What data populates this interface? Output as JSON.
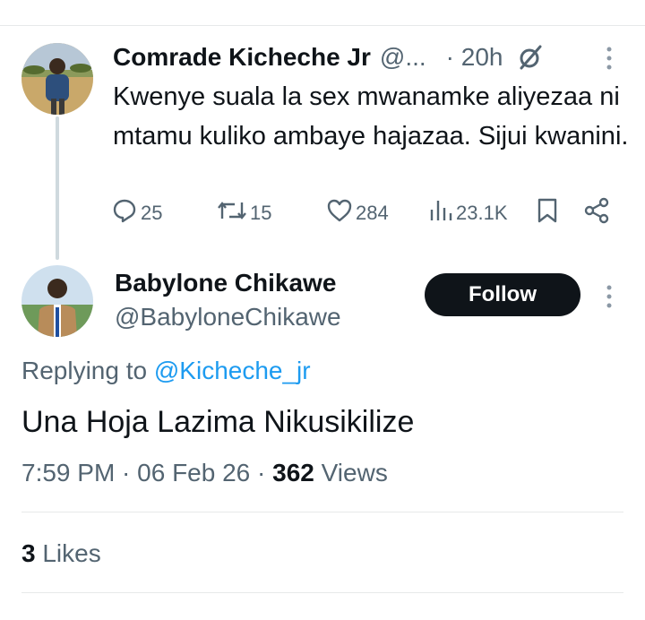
{
  "tweet1": {
    "author_name": "Comrade Kicheche Jr",
    "handle": "@...",
    "time": "· 20h",
    "text": "Kwenye suala la sex mwanamke aliyezaa ni mtamu kuliko ambaye hajazaa. Sijui kwanini.",
    "replies": "25",
    "retweets": "15",
    "likes": "284",
    "views": "23.1K",
    "icons": [
      "grok-icon",
      "more-icon",
      "reply-icon",
      "retweet-icon",
      "like-icon",
      "views-icon",
      "bookmark-icon",
      "share-icon"
    ]
  },
  "tweet2": {
    "author_name": "Babylone Chikawe",
    "handle": "@BabyloneChikawe",
    "follow_label": "Follow",
    "replying_prefix": "Replying to",
    "replying_to": "@Kicheche_jr",
    "text": "Una Hoja Lazima Nikusikilize",
    "timestamp": "7:59 PM · 06 Feb 26 ·",
    "views_count": "362",
    "views_label": "Views",
    "likes_count": "3",
    "likes_label": "Likes"
  },
  "colors": {
    "text_primary": "#0f1419",
    "text_secondary": "#536471",
    "link": "#1d9bf0",
    "divider": "#e7e9ea",
    "button_bg": "#0f1419"
  }
}
